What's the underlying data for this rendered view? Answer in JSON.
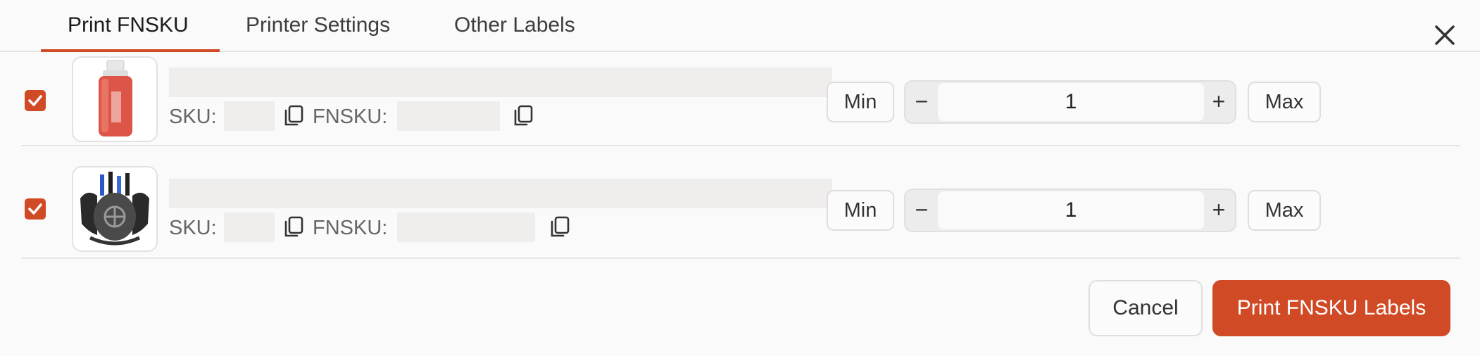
{
  "tabs": [
    {
      "label": "Print FNSKU",
      "active": true
    },
    {
      "label": "Printer Settings",
      "active": false
    },
    {
      "label": "Other Labels",
      "active": false
    }
  ],
  "rows": [
    {
      "checked": true,
      "image": "red-bottle-product",
      "title": "",
      "sku_label": "SKU:",
      "sku_value": "",
      "fnsku_label": "FNSKU:",
      "fnsku_value": "",
      "min_label": "Min",
      "quantity": "1",
      "max_label": "Max"
    },
    {
      "checked": true,
      "image": "dragon-pen-holder-product",
      "title": "",
      "sku_label": "SKU:",
      "sku_value": "",
      "fnsku_label": "FNSKU:",
      "fnsku_value": "",
      "min_label": "Min",
      "quantity": "1",
      "max_label": "Max"
    }
  ],
  "stepper": {
    "minus": "−",
    "plus": "+"
  },
  "footer": {
    "cancel_label": "Cancel",
    "print_label": "Print FNSKU Labels"
  },
  "icons": {
    "close": "close-icon",
    "copy": "copy-icon",
    "check": "check-icon"
  },
  "colors": {
    "accent": "#d14a26",
    "placeholder": "#efeeec",
    "border": "#e0e0e0"
  }
}
